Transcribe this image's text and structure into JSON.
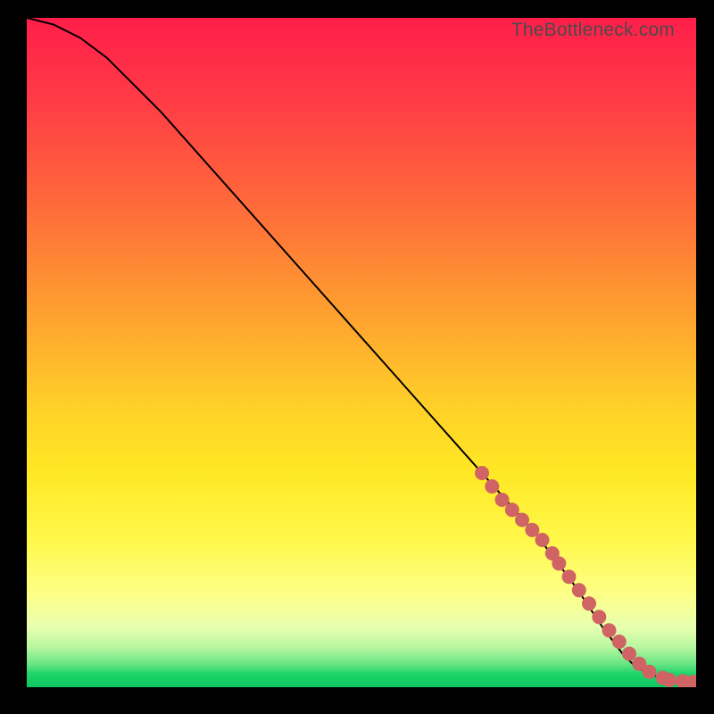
{
  "watermark": "TheBottleneck.com",
  "chart_data": {
    "type": "line",
    "title": "",
    "xlabel": "",
    "ylabel": "",
    "xlim": [
      0,
      100
    ],
    "ylim": [
      0,
      100
    ],
    "curve": {
      "name": "bottleneck-curve",
      "x": [
        0,
        4,
        8,
        12,
        16,
        20,
        28,
        36,
        44,
        52,
        60,
        68,
        76,
        82,
        86,
        89,
        91,
        93,
        95,
        97,
        99,
        100
      ],
      "y": [
        100,
        99,
        97,
        94,
        90,
        86,
        77,
        68,
        59,
        50,
        41,
        32,
        23,
        15,
        9,
        5,
        3,
        2,
        1.3,
        1,
        0.8,
        0.8
      ]
    },
    "markers": {
      "name": "data-points",
      "color": "#d06464",
      "x": [
        68,
        69.5,
        71,
        72.5,
        74,
        75.5,
        77,
        78.5,
        79.5,
        81,
        82.5,
        84,
        85.5,
        87,
        88.5,
        90,
        91.5,
        93,
        95,
        96,
        98,
        99.5
      ],
      "y": [
        32,
        30,
        28,
        26.5,
        25,
        23.5,
        22,
        20,
        18.5,
        16.5,
        14.5,
        12.5,
        10.5,
        8.5,
        6.8,
        5,
        3.5,
        2.3,
        1.4,
        1.1,
        0.9,
        0.8
      ]
    }
  }
}
